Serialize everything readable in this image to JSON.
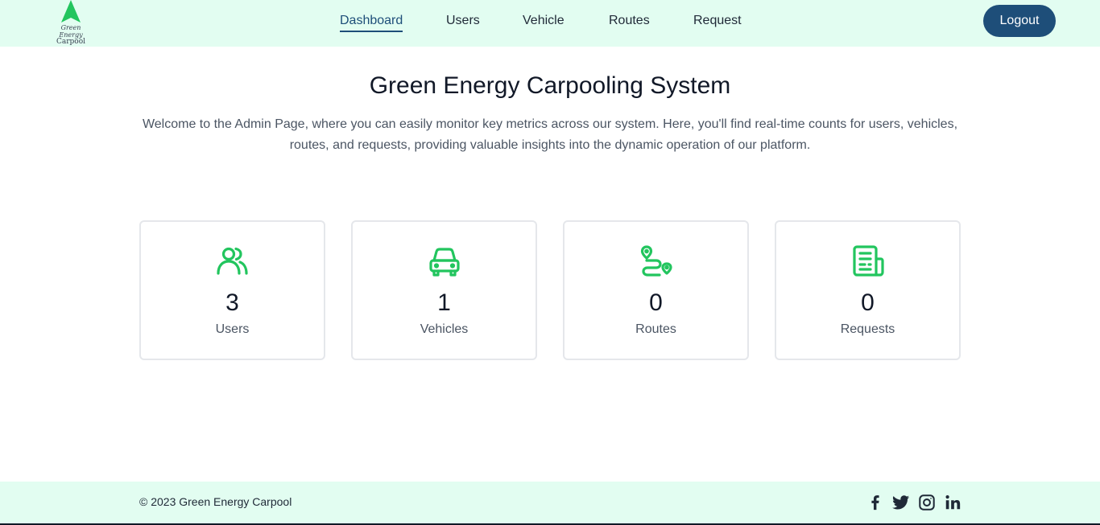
{
  "logo": {
    "line1": "Green Energy",
    "line2": "Carpool",
    "color": "#22c55e"
  },
  "nav": {
    "items": [
      {
        "label": "Dashboard"
      },
      {
        "label": "Users"
      },
      {
        "label": "Vehicle"
      },
      {
        "label": "Routes"
      },
      {
        "label": "Request"
      }
    ],
    "active": "Dashboard",
    "logout_label": "Logout"
  },
  "main": {
    "title": "Green Energy Carpooling System",
    "intro_line1": "Welcome to the Admin Page, where you can easily monitor key metrics across our system. Here, you'll find real-time counts for users, vehicles,",
    "intro_line2": "routes, and requests, providing valuable insights into the dynamic operation of our platform.",
    "cards": [
      {
        "icon": "users-icon",
        "count": "3",
        "label": "Users"
      },
      {
        "icon": "car-icon",
        "count": "1",
        "label": "Vehicles"
      },
      {
        "icon": "route-icon",
        "count": "0",
        "label": "Routes"
      },
      {
        "icon": "document-icon",
        "count": "0",
        "label": "Requests"
      }
    ]
  },
  "footer": {
    "copyright": "© 2023 Green Energy Carpool",
    "social": [
      "facebook-icon",
      "twitter-icon",
      "instagram-icon",
      "linkedin-icon"
    ]
  },
  "colors": {
    "header_bg": "#e2fdf1",
    "accent_navy": "#1e4e79",
    "icon_green": "#22c55e"
  }
}
